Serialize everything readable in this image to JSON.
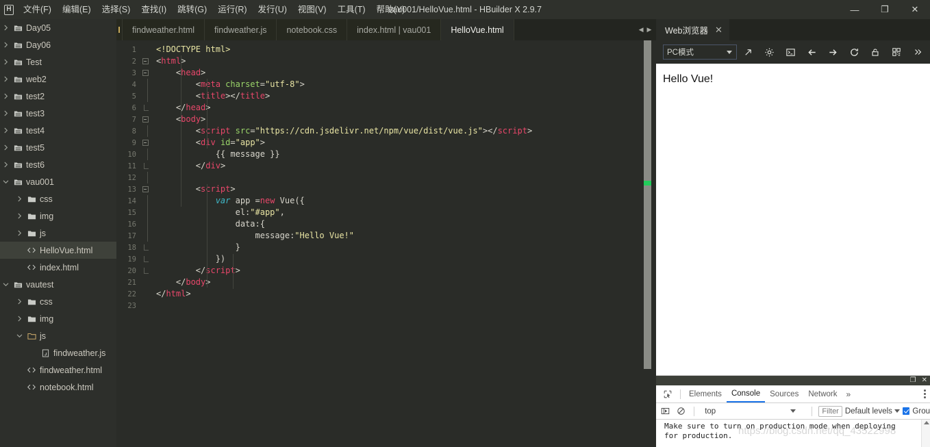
{
  "window": {
    "title": "vau001/HelloVue.html - HBuilder X 2.9.7",
    "logo_letter": "H",
    "minimize": "—",
    "maximize": "❐",
    "close": "✕"
  },
  "menubar": {
    "items": [
      {
        "label": "文件(F)",
        "name": "menu-file"
      },
      {
        "label": "编辑(E)",
        "name": "menu-edit"
      },
      {
        "label": "选择(S)",
        "name": "menu-select"
      },
      {
        "label": "查找(I)",
        "name": "menu-find"
      },
      {
        "label": "跳转(G)",
        "name": "menu-goto"
      },
      {
        "label": "运行(R)",
        "name": "menu-run"
      },
      {
        "label": "发行(U)",
        "name": "menu-publish"
      },
      {
        "label": "视图(V)",
        "name": "menu-view"
      },
      {
        "label": "工具(T)",
        "name": "menu-tools"
      },
      {
        "label": "帮助(Y)",
        "name": "menu-help"
      }
    ]
  },
  "sidebar": {
    "tree": [
      {
        "label": "Day05",
        "type": "project",
        "indent": 0,
        "state": "collapsed",
        "selected": false
      },
      {
        "label": "Day06",
        "type": "project",
        "indent": 0,
        "state": "collapsed",
        "selected": false
      },
      {
        "label": "Test",
        "type": "project",
        "indent": 0,
        "state": "collapsed",
        "selected": false
      },
      {
        "label": "web2",
        "type": "project",
        "indent": 0,
        "state": "collapsed",
        "selected": false
      },
      {
        "label": "test2",
        "type": "project",
        "indent": 0,
        "state": "collapsed",
        "selected": false
      },
      {
        "label": "test3",
        "type": "project",
        "indent": 0,
        "state": "collapsed",
        "selected": false
      },
      {
        "label": "test4",
        "type": "project",
        "indent": 0,
        "state": "collapsed",
        "selected": false
      },
      {
        "label": "test5",
        "type": "project",
        "indent": 0,
        "state": "collapsed",
        "selected": false
      },
      {
        "label": "test6",
        "type": "project",
        "indent": 0,
        "state": "collapsed",
        "selected": false
      },
      {
        "label": "vau001",
        "type": "project",
        "indent": 0,
        "state": "expanded",
        "selected": false
      },
      {
        "label": "css",
        "type": "folder",
        "indent": 1,
        "state": "collapsed",
        "selected": false
      },
      {
        "label": "img",
        "type": "folder",
        "indent": 1,
        "state": "collapsed",
        "selected": false
      },
      {
        "label": "js",
        "type": "folder",
        "indent": 1,
        "state": "collapsed",
        "selected": false
      },
      {
        "label": "HelloVue.html",
        "type": "html",
        "indent": 1,
        "state": "none",
        "selected": true
      },
      {
        "label": "index.html",
        "type": "html",
        "indent": 1,
        "state": "none",
        "selected": false
      },
      {
        "label": "vautest",
        "type": "project",
        "indent": 0,
        "state": "expanded",
        "selected": false
      },
      {
        "label": "css",
        "type": "folder",
        "indent": 1,
        "state": "collapsed",
        "selected": false
      },
      {
        "label": "img",
        "type": "folder",
        "indent": 1,
        "state": "collapsed",
        "selected": false
      },
      {
        "label": "js",
        "type": "folder",
        "indent": 1,
        "state": "expanded",
        "selected": false
      },
      {
        "label": "findweather.js",
        "type": "js",
        "indent": 2,
        "state": "none",
        "selected": false
      },
      {
        "label": "findweather.html",
        "type": "html",
        "indent": 1,
        "state": "none",
        "selected": false
      },
      {
        "label": "notebook.html",
        "type": "html",
        "indent": 1,
        "state": "none",
        "selected": false
      }
    ]
  },
  "editor": {
    "tabs": [
      {
        "label": "findweather.html",
        "active": false
      },
      {
        "label": "findweather.js",
        "active": false
      },
      {
        "label": "notebook.css",
        "active": false
      },
      {
        "label": "index.html | vau001",
        "active": false
      },
      {
        "label": "HelloVue.html",
        "active": true
      }
    ],
    "nav_prev": "◀",
    "nav_next": "▶",
    "total_lines": 23,
    "lines": [
      {
        "n": 1,
        "fold": "none",
        "tokens": [
          {
            "t": "doctype",
            "v": "<!DOCTYPE html>"
          }
        ],
        "indent": 1
      },
      {
        "n": 2,
        "fold": "open",
        "tokens": [
          {
            "t": "punct",
            "v": "<"
          },
          {
            "t": "tag",
            "v": "html"
          },
          {
            "t": "punct",
            "v": ">"
          }
        ],
        "indent": 0
      },
      {
        "n": 3,
        "fold": "open",
        "tokens": [
          {
            "t": "plain",
            "v": "    "
          },
          {
            "t": "punct",
            "v": "<"
          },
          {
            "t": "tag",
            "v": "head"
          },
          {
            "t": "punct",
            "v": ">"
          }
        ],
        "indent": 0
      },
      {
        "n": 4,
        "fold": "line",
        "tokens": [
          {
            "t": "plain",
            "v": "        "
          },
          {
            "t": "punct",
            "v": "<"
          },
          {
            "t": "tag",
            "v": "meta"
          },
          {
            "t": "plain",
            "v": " "
          },
          {
            "t": "attr",
            "v": "charset"
          },
          {
            "t": "punct",
            "v": "="
          },
          {
            "t": "str",
            "v": "\"utf-8\""
          },
          {
            "t": "punct",
            "v": ">"
          }
        ],
        "indent": 0
      },
      {
        "n": 5,
        "fold": "line",
        "tokens": [
          {
            "t": "plain",
            "v": "        "
          },
          {
            "t": "punct",
            "v": "<"
          },
          {
            "t": "tag",
            "v": "title"
          },
          {
            "t": "punct",
            "v": "></"
          },
          {
            "t": "tag",
            "v": "title"
          },
          {
            "t": "punct",
            "v": ">"
          }
        ],
        "indent": 0
      },
      {
        "n": 6,
        "fold": "close",
        "tokens": [
          {
            "t": "plain",
            "v": "    "
          },
          {
            "t": "punct",
            "v": "</"
          },
          {
            "t": "tag",
            "v": "head"
          },
          {
            "t": "punct",
            "v": ">"
          }
        ],
        "indent": 0
      },
      {
        "n": 7,
        "fold": "open",
        "tokens": [
          {
            "t": "plain",
            "v": "    "
          },
          {
            "t": "punct",
            "v": "<"
          },
          {
            "t": "tag",
            "v": "body"
          },
          {
            "t": "punct",
            "v": ">"
          }
        ],
        "indent": 0
      },
      {
        "n": 8,
        "fold": "line",
        "tokens": [
          {
            "t": "plain",
            "v": "        "
          },
          {
            "t": "punct",
            "v": "<"
          },
          {
            "t": "tag",
            "v": "script"
          },
          {
            "t": "plain",
            "v": " "
          },
          {
            "t": "attr",
            "v": "src"
          },
          {
            "t": "punct",
            "v": "="
          },
          {
            "t": "str",
            "v": "\"https://cdn.jsdelivr.net/npm/vue/dist/vue.js\""
          },
          {
            "t": "punct",
            "v": "></"
          },
          {
            "t": "tag",
            "v": "script"
          },
          {
            "t": "punct",
            "v": ">"
          }
        ],
        "indent": 0
      },
      {
        "n": 9,
        "fold": "open",
        "tokens": [
          {
            "t": "plain",
            "v": "        "
          },
          {
            "t": "punct",
            "v": "<"
          },
          {
            "t": "tag",
            "v": "div"
          },
          {
            "t": "plain",
            "v": " "
          },
          {
            "t": "attr",
            "v": "id"
          },
          {
            "t": "punct",
            "v": "="
          },
          {
            "t": "str",
            "v": "\"app\""
          },
          {
            "t": "punct",
            "v": ">"
          }
        ],
        "indent": 0
      },
      {
        "n": 10,
        "fold": "line",
        "tokens": [
          {
            "t": "plain",
            "v": "            {{ message }}"
          }
        ],
        "indent": 0
      },
      {
        "n": 11,
        "fold": "close",
        "tokens": [
          {
            "t": "plain",
            "v": "        "
          },
          {
            "t": "punct",
            "v": "</"
          },
          {
            "t": "tag",
            "v": "div"
          },
          {
            "t": "punct",
            "v": ">"
          }
        ],
        "indent": 0
      },
      {
        "n": 12,
        "fold": "line",
        "tokens": [
          {
            "t": "plain",
            "v": ""
          }
        ],
        "indent": 0
      },
      {
        "n": 13,
        "fold": "open",
        "tokens": [
          {
            "t": "plain",
            "v": "        "
          },
          {
            "t": "punct",
            "v": "<"
          },
          {
            "t": "tag",
            "v": "script"
          },
          {
            "t": "punct",
            "v": ">"
          }
        ],
        "indent": 0
      },
      {
        "n": 14,
        "fold": "line",
        "tokens": [
          {
            "t": "plain",
            "v": "            "
          },
          {
            "t": "var",
            "v": "var"
          },
          {
            "t": "plain",
            "v": " app ="
          },
          {
            "t": "kw",
            "v": "new"
          },
          {
            "t": "plain",
            "v": " Vue({"
          }
        ],
        "indent": 0
      },
      {
        "n": 15,
        "fold": "line",
        "tokens": [
          {
            "t": "plain",
            "v": "                el:"
          },
          {
            "t": "str",
            "v": "\"#app\""
          },
          {
            "t": "plain",
            "v": ","
          }
        ],
        "indent": 0
      },
      {
        "n": 16,
        "fold": "line",
        "tokens": [
          {
            "t": "plain",
            "v": "                data:{"
          }
        ],
        "indent": 0
      },
      {
        "n": 17,
        "fold": "line",
        "tokens": [
          {
            "t": "plain",
            "v": "                    message:"
          },
          {
            "t": "str",
            "v": "\"Hello Vue!\""
          }
        ],
        "indent": 0
      },
      {
        "n": 18,
        "fold": "close",
        "tokens": [
          {
            "t": "plain",
            "v": "                }"
          }
        ],
        "indent": 0
      },
      {
        "n": 19,
        "fold": "close",
        "tokens": [
          {
            "t": "plain",
            "v": "            })"
          }
        ],
        "indent": 0
      },
      {
        "n": 20,
        "fold": "close",
        "tokens": [
          {
            "t": "plain",
            "v": "        "
          },
          {
            "t": "punct",
            "v": "</"
          },
          {
            "t": "tag",
            "v": "script"
          },
          {
            "t": "punct",
            "v": ">"
          }
        ],
        "indent": 0
      },
      {
        "n": 21,
        "fold": "none",
        "tokens": [
          {
            "t": "plain",
            "v": "    "
          },
          {
            "t": "punct",
            "v": "</"
          },
          {
            "t": "tag",
            "v": "body"
          },
          {
            "t": "punct",
            "v": ">"
          }
        ],
        "indent": 0
      },
      {
        "n": 22,
        "fold": "none",
        "tokens": [
          {
            "t": "punct",
            "v": "</"
          },
          {
            "t": "tag",
            "v": "html"
          },
          {
            "t": "punct",
            "v": ">"
          }
        ],
        "indent": 0
      },
      {
        "n": 23,
        "fold": "none",
        "tokens": [
          {
            "t": "plain",
            "v": ""
          }
        ],
        "indent": 0
      }
    ]
  },
  "browser_panel": {
    "tab_label": "Web浏览器",
    "tab_close": "✕",
    "mode_label": "PC模式",
    "toolbar_icons": [
      {
        "name": "open-external-icon"
      },
      {
        "name": "gear-icon"
      },
      {
        "name": "console-icon"
      },
      {
        "name": "back-arrow-icon"
      },
      {
        "name": "forward-arrow-icon"
      },
      {
        "name": "reload-icon"
      },
      {
        "name": "unlock-icon"
      },
      {
        "name": "qrcode-icon"
      },
      {
        "name": "chevron-double-right-icon"
      }
    ],
    "preview_text": "Hello Vue!"
  },
  "devtools": {
    "restore_glyph": "❐",
    "close_glyph": "✕",
    "tabs": [
      {
        "label": "Elements",
        "active": false
      },
      {
        "label": "Console",
        "active": true
      },
      {
        "label": "Sources",
        "active": false
      },
      {
        "label": "Network",
        "active": false
      }
    ],
    "more_tabs": "»",
    "context": "top",
    "filter_placeholder": "Filter",
    "levels_label": "Default levels",
    "group_label": "Grou",
    "console_message": "Make sure to turn on production mode when deploying\nfor production."
  },
  "watermark": {
    "text": "https://blog.csdn.net/qq_43522998"
  },
  "colors": {
    "accent": "#1a73e8",
    "scroll_marker": "#22cc5a",
    "tag": "#e8476a",
    "attr": "#9ad469",
    "string": "#e8e4a3"
  }
}
